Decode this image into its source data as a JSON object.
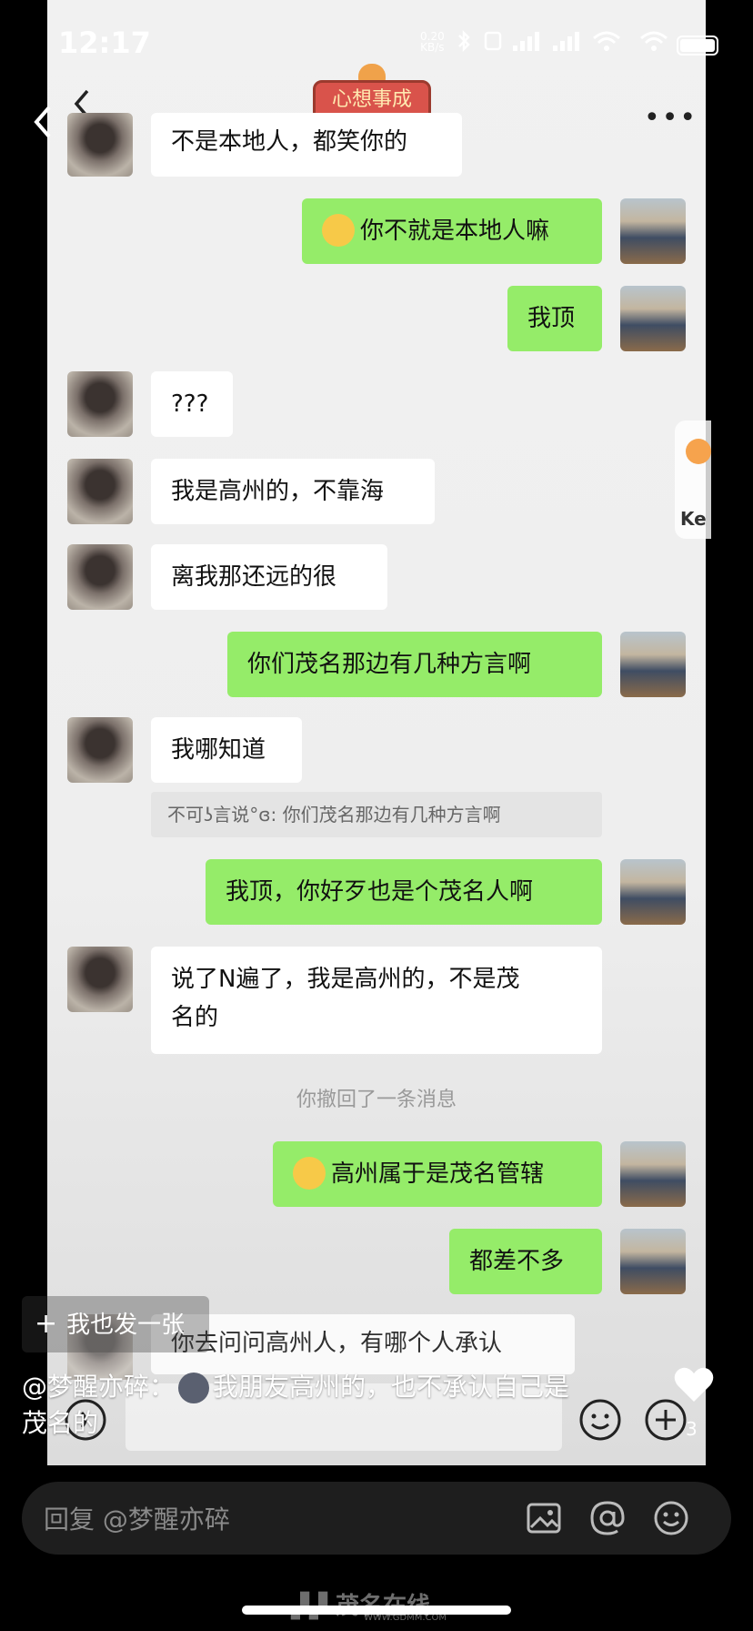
{
  "status_bar": {
    "time": "12:17",
    "net_speed_value": "0.20",
    "net_speed_unit": "KB/s"
  },
  "header": {
    "title_badge": "心想事成"
  },
  "chat": {
    "partial_top_text": "不是本地人，都笑你的",
    "messages": [
      {
        "side": "right",
        "text": "你不就是本地人嘛",
        "emoji": true
      },
      {
        "side": "right",
        "text": "我顶"
      },
      {
        "side": "left",
        "text": "???"
      },
      {
        "side": "left",
        "text": "我是高州的，不靠海"
      },
      {
        "side": "left",
        "text": "离我那还远的很"
      },
      {
        "side": "right",
        "text": "你们茂名那边有几种方言啊"
      },
      {
        "side": "left",
        "text": "我哪知道"
      },
      {
        "side": "right",
        "text": "我顶，你好歹也是个茂名人啊"
      },
      {
        "side": "left",
        "line1": "说了N遍了，我是高州的，不是茂",
        "line2": "名的"
      },
      {
        "side": "right",
        "text": "高州属于是茂名管辖",
        "emoji": true
      },
      {
        "side": "right",
        "text": "都差不多"
      },
      {
        "side": "left",
        "text": "你去问问高州人，有哪个人承认"
      }
    ],
    "quote": "不可ʖ言说°ɞ: 你们茂名那边有几种方言啊",
    "recall_notice": "你撤回了一条消息"
  },
  "side_tab": {
    "label": "Ke"
  },
  "overlay": {
    "post_button": "我也发一张",
    "comment_user": "@梦醒亦碎：",
    "comment_text_1": "我朋友高州的，也不承认自己是",
    "comment_text_2": "茂名的",
    "like_count": "3"
  },
  "reply_bar": {
    "placeholder": "回复 @梦醒亦碎"
  },
  "watermark": {
    "text": "茂名在线",
    "url": "WWW.GDMM.COM"
  },
  "colors": {
    "green_bubble": "#95ec69",
    "white_bubble": "#ffffff",
    "chat_bg": "#ededed"
  },
  "icons": [
    "back-chevron-icon",
    "more-icon",
    "image-icon",
    "at-icon",
    "emoji-icon",
    "voice-icon",
    "plus-icon",
    "heart-icon",
    "wifi-icon",
    "bluetooth-icon",
    "signal-icon",
    "battery-icon"
  ]
}
